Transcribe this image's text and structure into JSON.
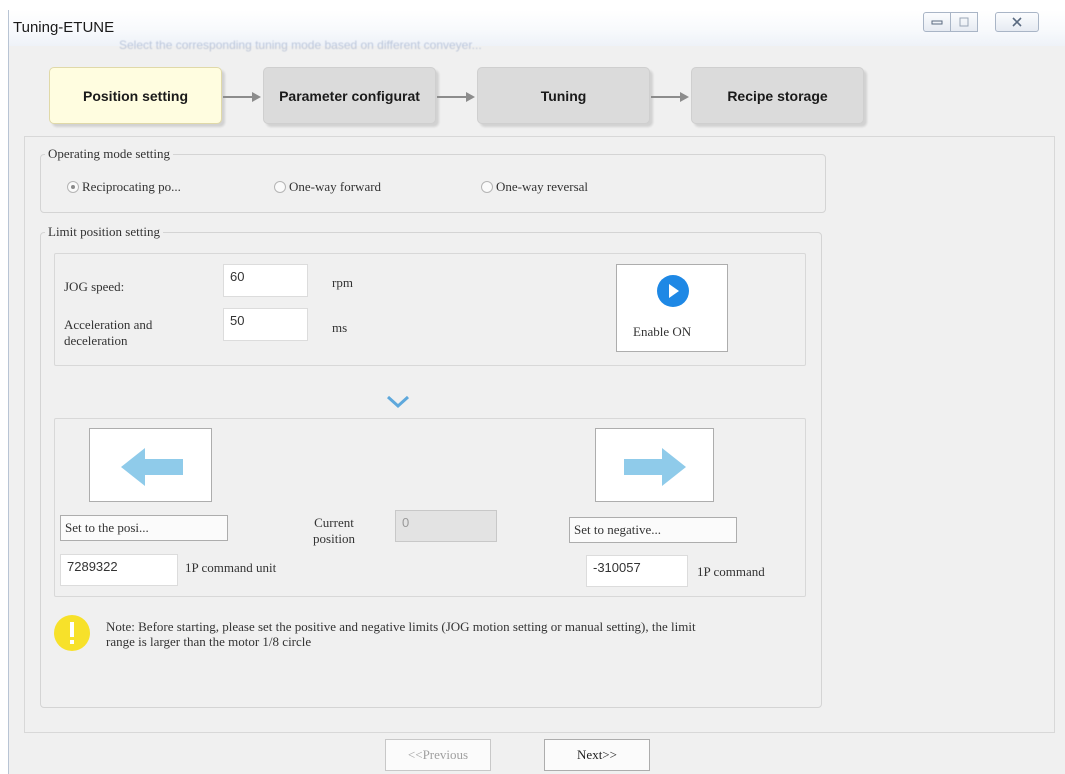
{
  "window": {
    "title": "Tuning-ETUNE",
    "ghost_text": "Select the corresponding tuning mode based on different conveyer..."
  },
  "steps": [
    {
      "label": "Position setting",
      "active": true
    },
    {
      "label": "Parameter configurat",
      "active": false
    },
    {
      "label": "Tuning",
      "active": false
    },
    {
      "label": "Recipe storage",
      "active": false
    }
  ],
  "operating_mode": {
    "legend": "Operating mode setting",
    "options": [
      {
        "label": "Reciprocating po...",
        "checked": true
      },
      {
        "label": "One-way forward",
        "checked": false
      },
      {
        "label": "One-way reversal",
        "checked": false
      }
    ]
  },
  "limit": {
    "legend": "Limit position setting",
    "jog_speed_label": "JOG speed:",
    "jog_speed_value": "60",
    "jog_speed_unit": "rpm",
    "accel_label": "Acceleration and deceleration",
    "accel_value": "50",
    "accel_unit": "ms",
    "enable_label": "Enable ON",
    "set_positive_label": "Set to the posi...",
    "current_position_label": "Current position",
    "current_position_value": "0",
    "set_negative_label": "Set to negative...",
    "positive_value": "7289322",
    "positive_unit": "1P command unit",
    "negative_value": "-310057",
    "negative_unit": "1P command"
  },
  "note": {
    "text": "Note: Before starting, please set the positive and negative limits (JOG motion setting or manual setting), the limit range is larger than the motor 1/8 circle"
  },
  "nav": {
    "previous_label": "<<Previous",
    "next_label": "Next>>"
  },
  "colors": {
    "accent_blue": "#1e88e5",
    "arrow_blue": "#8fcbea",
    "chevron_blue": "#5ea8dc",
    "note_yellow": "#f7e12a"
  }
}
